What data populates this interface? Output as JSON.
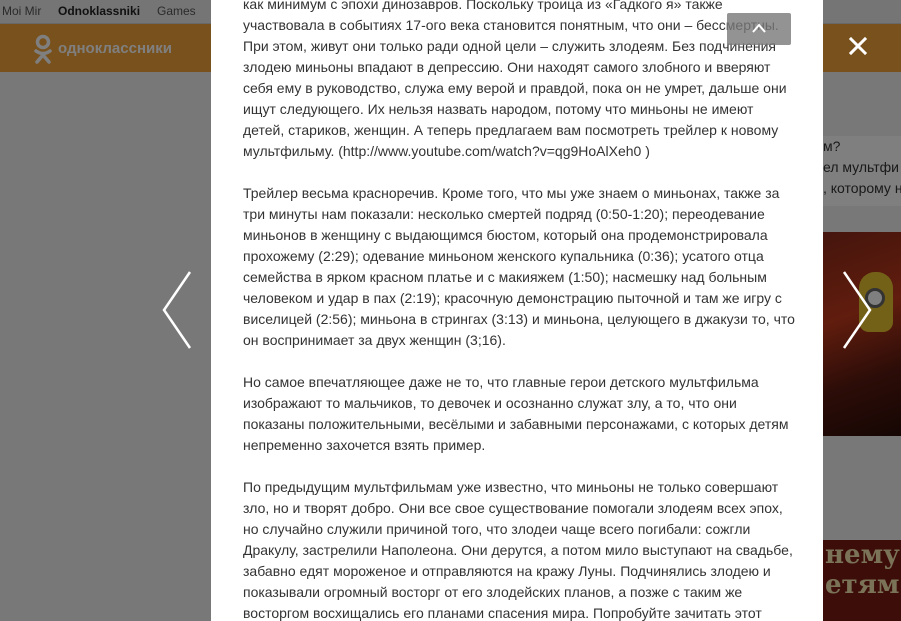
{
  "topnav": {
    "items": [
      "Moi Mir",
      "Odnoklassniki",
      "Games"
    ],
    "active": "Odnoklassniki"
  },
  "header": {
    "site_name": "одноклассники",
    "brand_color": "#f2a23a"
  },
  "background": {
    "right_text_lines": [
      "м?",
      "ел мультфи",
      ", которому н"
    ],
    "banner_lines": [
      "нему н",
      "етям?"
    ]
  },
  "article": {
    "paragraphs": [
      "как минимум с эпохи динозавров. Поскольку троица из «Гадкого я» также участвовала в событиях 17-ого века становится понятным, что они – бессмертны. При этом, живут они только ради одной цели – служить злодеям. Без подчинения злодею миньоны впадают в депрессию. Они находят самого злобного и вверяют себя ему в руководство, служа ему верой и правдой, пока он не умрет, дальше они ищут следующего. Их нельзя назвать народом, потому что миньоны не имеют детей, стариков, женщин. А теперь предлагаем вам посмотреть трейлер к новому мультфильму. (http://www.youtube.com/watch?v=qg9HoAlXeh0 )",
      "Трейлер весьма красноречив. Кроме того, что мы уже знаем о миньонах, также за три минуты нам показали: несколько смертей подряд (0:50-1:20); переодевание миньонов в женщину с выдающимся бюстом, который она продемонстрировала прохожему (2:29); одевание миньоном женского купальника (0:36); усатого отца семейства в ярком красном платье и с макияжем (1:50); насмешку над больным человеком и удар в пах (2:19); красочную демонстрацию пыточной и там же игру с виселицей (2:56); миньона в стрингах (3:13) и миньона, целующего в джакузи то, что он воспринимает за двух женщин (3;16).",
      "Но самое впечатляющее даже не то, что главные герои детского мультфильма изображают то мальчиков, то девочек и осознанно служат злу,  а то, что они показаны положительными, весёлыми и забавными персонажами, с которых детям непременно захочется взять пример.",
      "По предыдущим мультфильмам уже известно, что миньоны не только совершают зло, но и творят добро. Они все свое существование помогали злодеям всех эпох, но случайно служили причиной того, что злодеи чаще всего погибали: сожгли Дракулу, застрелили Наполеона. Они дерутся, а потом мило выступают на свадьбе, забавно едят мороженое и отправляются на кражу Луны.  Подчинялись злодею и показывали огромный восторг от его злодейских планов, а позже с таким же восторгом восхищались его планами спасения мира. Попробуйте зачитать этот"
    ]
  },
  "controls": {
    "scroll_up_icon": "chevron-up-icon",
    "close_icon": "close-icon",
    "prev_icon": "chevron-left-icon",
    "next_icon": "chevron-right-icon"
  }
}
